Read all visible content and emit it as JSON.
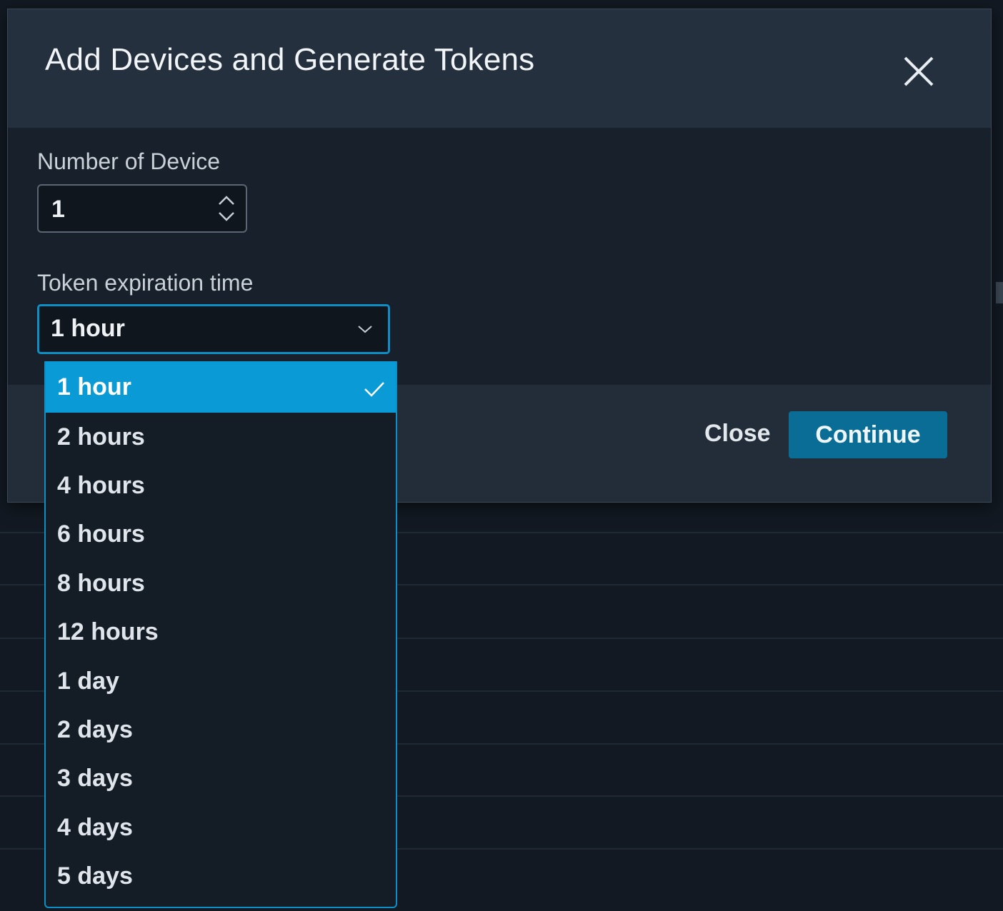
{
  "modal": {
    "title": "Add Devices and Generate Tokens",
    "close_icon": "close-icon"
  },
  "form": {
    "number_label": "Number of Device",
    "number_value": "1",
    "expiration_label": "Token expiration time",
    "expiration_selected": "1 hour"
  },
  "footer": {
    "close_label": "Close",
    "continue_label": "Continue"
  },
  "dropdown": {
    "options": [
      {
        "label": "1 hour",
        "selected": true
      },
      {
        "label": "2 hours",
        "selected": false
      },
      {
        "label": "4 hours",
        "selected": false
      },
      {
        "label": "6 hours",
        "selected": false
      },
      {
        "label": "8 hours",
        "selected": false
      },
      {
        "label": "12 hours",
        "selected": false
      },
      {
        "label": "1 day",
        "selected": false
      },
      {
        "label": "2 days",
        "selected": false
      },
      {
        "label": "3 days",
        "selected": false
      },
      {
        "label": "4 days",
        "selected": false
      },
      {
        "label": "5 days",
        "selected": false
      }
    ]
  },
  "colors": {
    "accent": "#0a9bd6",
    "primary_button": "#0a6d95"
  }
}
